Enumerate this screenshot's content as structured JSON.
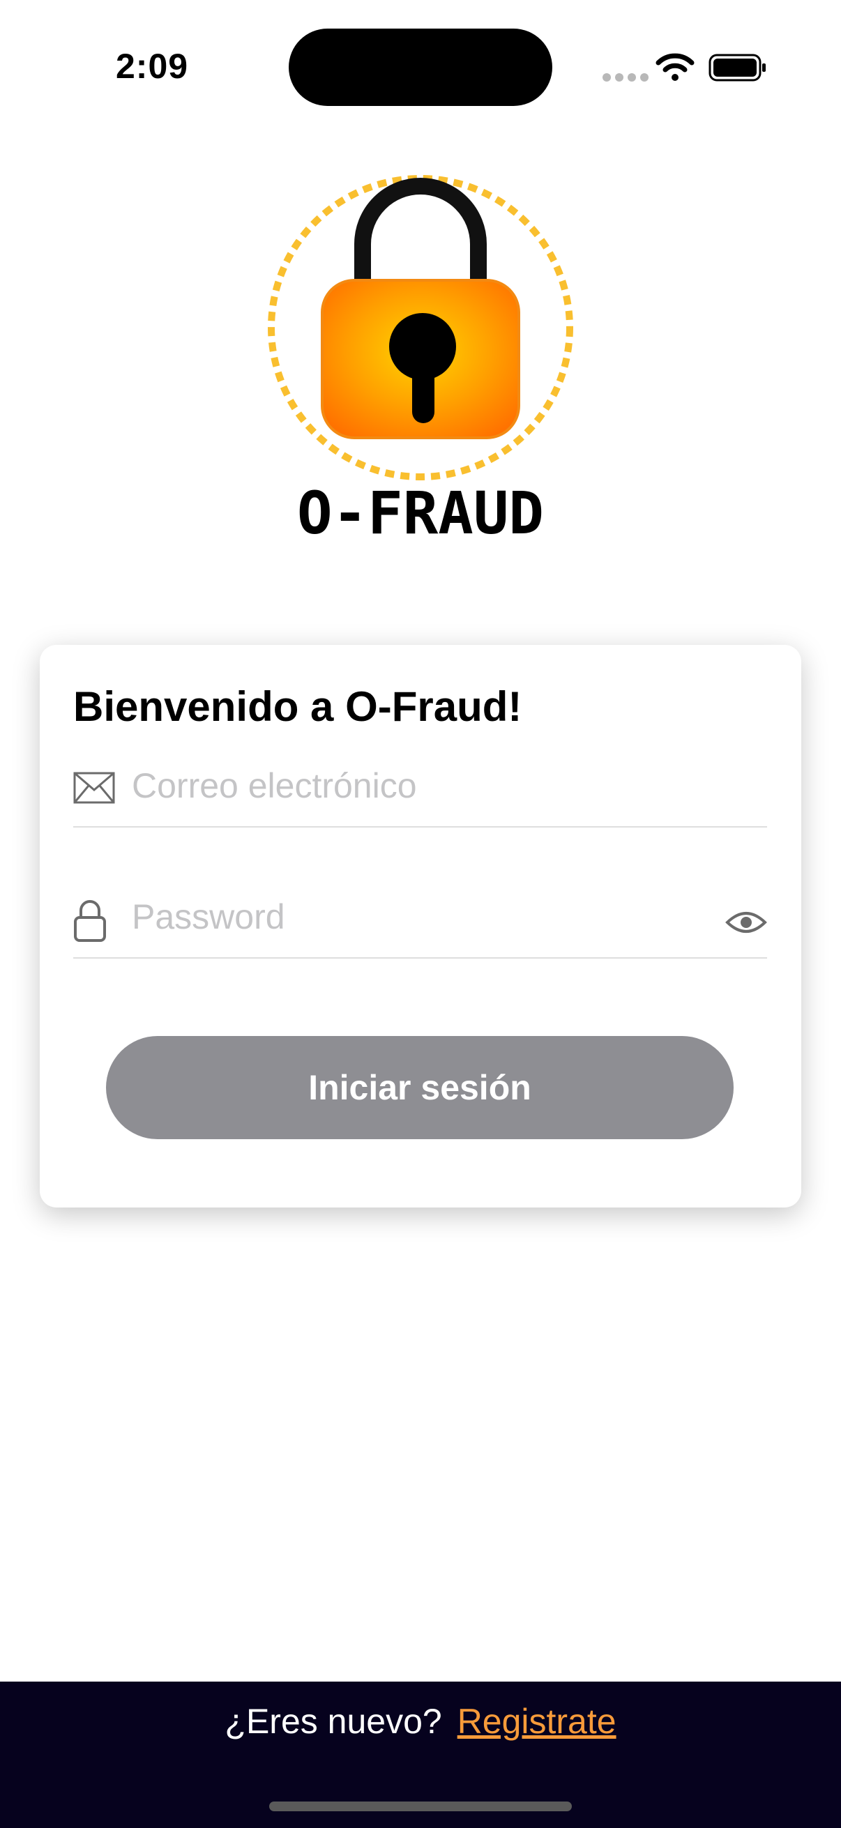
{
  "status_bar": {
    "time": "2:09"
  },
  "logo": {
    "text": "O-FRAUD"
  },
  "login_card": {
    "title": "Bienvenido a O-Fraud!",
    "email_placeholder": "Correo electrónico",
    "email_value": "",
    "password_placeholder": "Password",
    "password_value": "",
    "submit_label": "Iniciar sesión"
  },
  "footer": {
    "prompt": "¿Eres nuevo?",
    "register_label": "Registrate"
  },
  "colors": {
    "accent": "#f79b3a",
    "footer_bg": "#06021e",
    "button_disabled": "#8e8e93",
    "logo_orange": "#ff8c00"
  }
}
